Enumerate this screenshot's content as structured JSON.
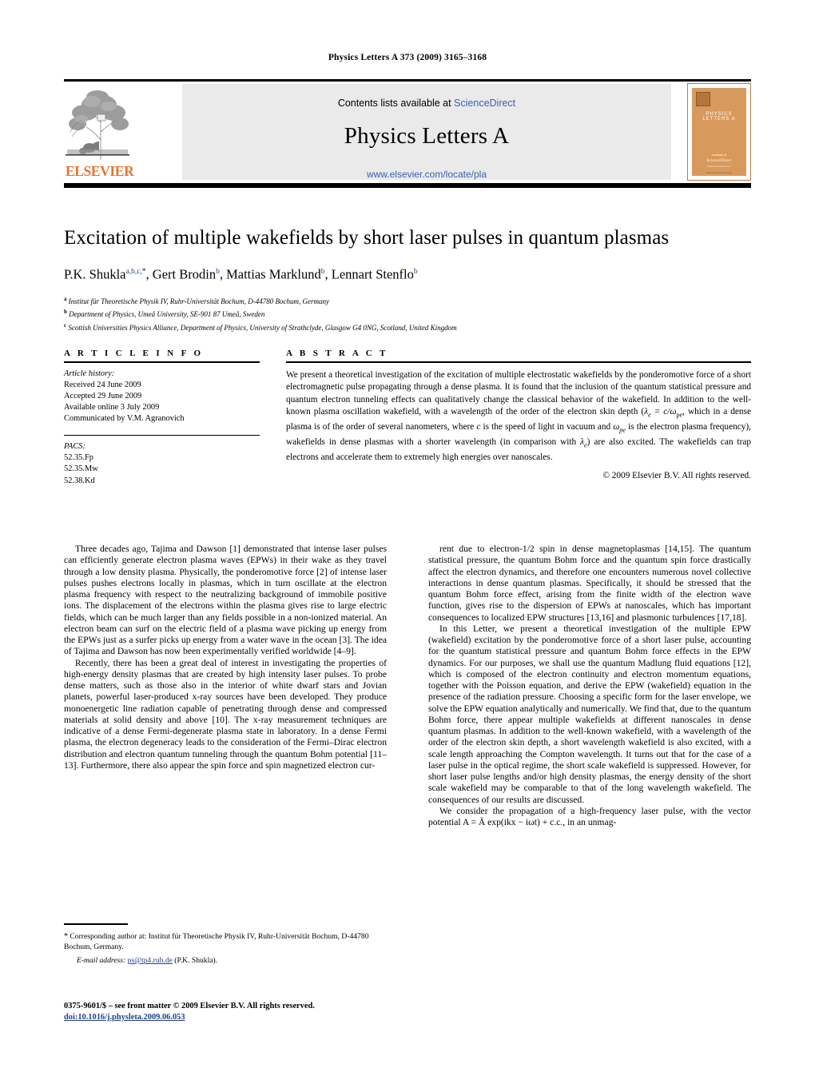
{
  "running_head": "Physics Letters A 373 (2009) 3165–3168",
  "masthead": {
    "contents_prefix": "Contents lists available at ",
    "sciencedirect": "ScienceDirect",
    "journal_name": "Physics Letters A",
    "journal_url": "www.elsevier.com/locate/pla",
    "publisher_wordmark": "ELSEVIER",
    "cover": {
      "title": "PHYSICS LETTERS A",
      "foot1": "Available at",
      "foot2": "ScienceDirect",
      "foot3": "www.sciencedirect.com",
      "foot4": "www.elsevier.com/locate/pla"
    }
  },
  "article": {
    "title": "Excitation of multiple wakefields by short laser pulses in quantum plasmas",
    "authors": [
      {
        "name": "P.K. Shukla",
        "marks": "a,b,c,",
        "star": "*"
      },
      {
        "name": "Gert Brodin",
        "marks": "b",
        "star": ""
      },
      {
        "name": "Mattias Marklund",
        "marks": "b",
        "star": ""
      },
      {
        "name": "Lennart Stenflo",
        "marks": "b",
        "star": ""
      }
    ],
    "affiliations": [
      {
        "mark": "a",
        "text": "Institut für Theoretische Physik IV, Ruhr-Universität Bochum, D-44780 Bochum, Germany"
      },
      {
        "mark": "b",
        "text": "Department of Physics, Umeå University, SE-901 87 Umeå, Sweden"
      },
      {
        "mark": "c",
        "text": "Scottish Universities Physics Alliance, Department of Physics, University of Strathclyde, Glasgow G4 0NG, Scotland, United Kingdom"
      }
    ]
  },
  "info": {
    "heading": "A R T I C L E   I N F O",
    "history_label": "Article history:",
    "history": [
      "Received 24 June 2009",
      "Accepted 29 June 2009",
      "Available online 3 July 2009",
      "Communicated by V.M. Agranovich"
    ],
    "pacs_label": "PACS:",
    "pacs": [
      "52.35.Fp",
      "52.35.Mw",
      "52.38.Kd"
    ]
  },
  "abstract": {
    "heading": "A B S T R A C T",
    "part1": "We present a theoretical investigation of the excitation of multiple electrostatic wakefields by the ponderomotive force of a short electromagnetic pulse propagating through a dense plasma. It is found that the inclusion of the quantum statistical pressure and quantum electron tunneling effects can qualitatively change the classical behavior of the wakefield. In addition to the well-known plasma oscillation wakefield, with a wavelength of the order of the electron skin depth (",
    "formula_lambda": "λ",
    "formula_lambda_sub": "e",
    "formula_eq": " = c/ω",
    "formula_eq_sub": "pe",
    "part2": ", which in a dense plasma is of the order of several nanometers, where ",
    "c_italic": "c",
    "part3": " is the speed of light in vacuum and ",
    "omega": "ω",
    "omega_sub": "pe",
    "part4": " is the electron plasma frequency), wakefields in dense plasmas with a shorter wavelength (in comparison with ",
    "lambda2": "λ",
    "lambda2_sub": "e",
    "part5": ") are also excited. The wakefields can trap electrons and accelerate them to extremely high energies over nanoscales.",
    "copyright": "© 2009 Elsevier B.V. All rights reserved."
  },
  "body": {
    "left": [
      "Three decades ago, Tajima and Dawson [1] demonstrated that intense laser pulses can efficiently generate electron plasma waves (EPWs) in their wake as they travel through a low density plasma. Physically, the ponderomotive force [2] of intense laser pulses pushes electrons locally in plasmas, which in turn oscillate at the electron plasma frequency with respect to the neutralizing background of immobile positive ions. The displacement of the electrons within the plasma gives rise to large electric fields, which can be much larger than any fields possible in a non-ionized material. An electron beam can surf on the electric field of a plasma wave picking up energy from the EPWs just as a surfer picks up energy from a water wave in the ocean [3]. The idea of Tajima and Dawson has now been experimentally verified worldwide [4–9].",
      "Recently, there has been a great deal of interest in investigating the properties of high-energy density plasmas that are created by high intensity laser pulses. To probe dense matters, such as those also in the interior of white dwarf stars and Jovian planets, powerful laser-produced x-ray sources have been developed. They produce monoenergetic line radiation capable of penetrating through dense and compressed materials at solid density and above [10]. The x-ray measurement techniques are indicative of a dense Fermi-degenerate plasma state in laboratory. In a dense Fermi plasma, the electron degeneracy leads to the consideration of the Fermi–Dirac electron distribution and electron quantum tunneling through the quantum Bohm potential [11–13]. Furthermore, there also appear the spin force and spin magnetized electron cur-"
    ],
    "right": [
      "rent due to electron-1/2 spin in dense magnetoplasmas [14,15]. The quantum statistical pressure, the quantum Bohm force and the quantum spin force drastically affect the electron dynamics, and therefore one encounters numerous novel collective interactions in dense quantum plasmas. Specifically, it should be stressed that the quantum Bohm force effect, arising from the finite width of the electron wave function, gives rise to the dispersion of EPWs at nanoscales, which has important consequences to localized EPW structures [13,16] and plasmonic turbulences [17,18].",
      "In this Letter, we present a theoretical investigation of the multiple EPW (wakefield) excitation by the ponderomotive force of a short laser pulse, accounting for the quantum statistical pressure and quantum Bohm force effects in the EPW dynamics. For our purposes, we shall use the quantum Madlung fluid equations [12], which is composed of the electron continuity and electron momentum equations, together with the Poisson equation, and derive the EPW (wakefield) equation in the presence of the radiation pressure. Choosing a specific form for the laser envelope, we solve the EPW equation analytically and numerically. We find that, due to the quantum Bohm force, there appear multiple wakefields at different nanoscales in dense quantum plasmas. In addition to the well-known wakefield, with a wavelength of the order of the electron skin depth, a short wavelength wakefield is also excited, with a scale length approaching the Compton wavelength. It turns out that for the case of a laser pulse in the optical regime, the short scale wakefield is suppressed. However, for short laser pulse lengths and/or high density plasmas, the energy density of the short scale wakefield may be comparable to that of the long wavelength wakefield. The consequences of our results are discussed.",
      "We consider the propagation of a high-frequency laser pulse, with the vector potential A = Ã exp(ikx − iωt) + c.c., in an unmag-"
    ]
  },
  "footnote": {
    "star": "*",
    "corresponding": "Corresponding author at: Institut für Theoretische Physik IV, Ruhr-Universität Bochum, D-44780 Bochum, Germany.",
    "email_label": "E-mail address:",
    "email": "ps@tp4.rub.de",
    "email_owner": "(P.K. Shukla)."
  },
  "imprint": {
    "line1": "0375-9601/$ – see front matter  © 2009 Elsevier B.V. All rights reserved.",
    "doi": "doi:10.1016/j.physleta.2009.06.053"
  },
  "colors": {
    "link": "#3a5fae",
    "reference": "#22408c",
    "elsevier_orange": "#e8722c",
    "panel_gray": "#eaeaea",
    "cover_orange": "#d89a5c"
  }
}
